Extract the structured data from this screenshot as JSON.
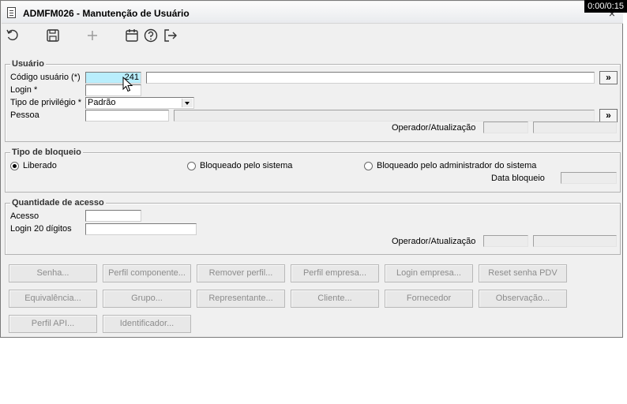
{
  "window": {
    "title": "ADMFM026 - Manutenção de Usuário",
    "close_glyph": "×"
  },
  "overlay": {
    "timer": "0:00/0:15"
  },
  "toolbar": {
    "icons": [
      "undo-icon",
      "save-icon",
      "add-icon",
      "calendar-icon",
      "help-icon",
      "exit-icon"
    ]
  },
  "usuario": {
    "group_title": "Usuário",
    "codigo_label": "Código usuário (*)",
    "codigo_value": "241",
    "descricao_value": "",
    "login_label": "Login *",
    "login_value": "",
    "tipo_label": "Tipo de privilégio *",
    "tipo_value": "Padrão",
    "pessoa_label": "Pessoa",
    "pessoa_value": "",
    "operador_label": "Operador/Atualização",
    "lookup_glyph": "»"
  },
  "bloqueio": {
    "group_title": "Tipo de bloqueio",
    "options": [
      "Liberado",
      "Bloqueado pelo sistema",
      "Bloqueado pelo administrador do sistema"
    ],
    "selected": "Liberado",
    "data_label": "Data bloqueio"
  },
  "acesso": {
    "group_title": "Quantidade de acesso",
    "acesso_label": "Acesso",
    "login20_label": "Login 20 dígitos",
    "operador_label": "Operador/Atualização"
  },
  "buttons": {
    "row1": [
      "Senha...",
      "Perfil componente...",
      "Remover perfil...",
      "Perfil empresa...",
      "Login empresa...",
      "Reset senha PDV"
    ],
    "row2": [
      "Equivalência...",
      "Grupo...",
      "Representante...",
      "Cliente...",
      "Fornecedor",
      "Observação..."
    ],
    "row3": [
      "Perfil API...",
      "Identificador..."
    ]
  },
  "colors": {
    "highlight_field": "#b9eefc",
    "window_bg": "#f0f0f0",
    "disabled_text": "#8c8c8c"
  }
}
